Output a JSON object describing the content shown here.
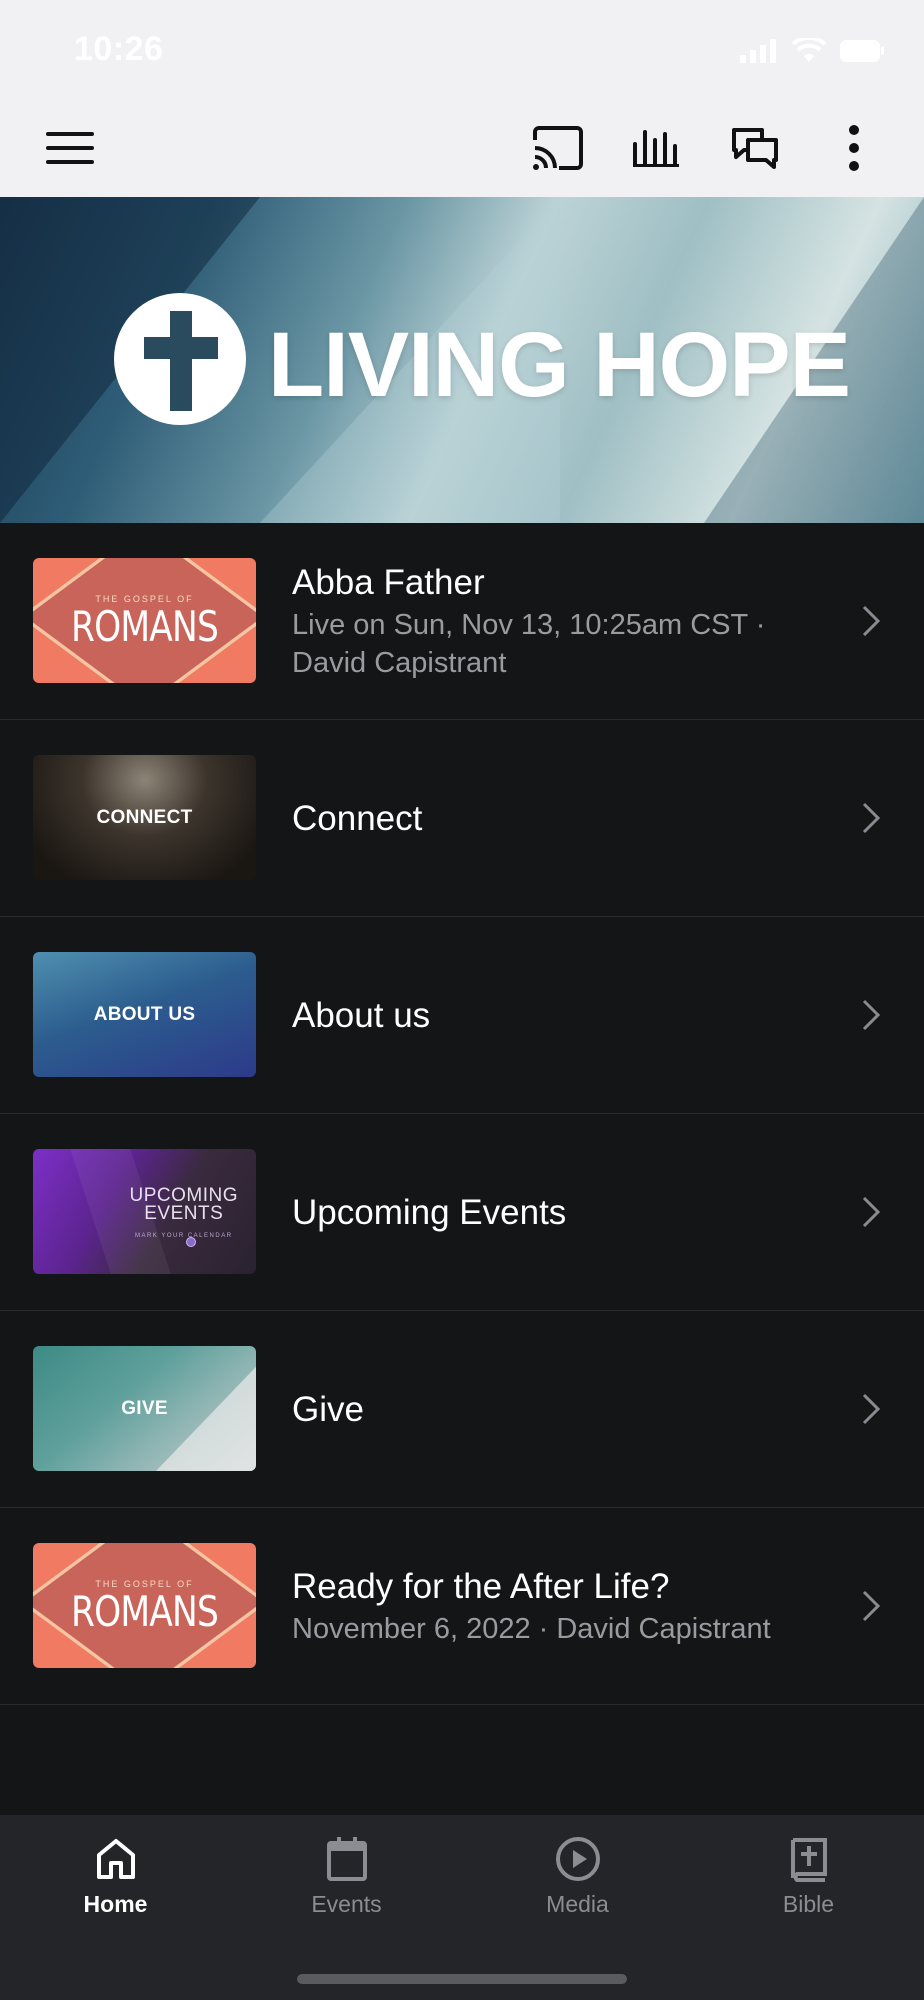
{
  "status_bar": {
    "time": "10:26"
  },
  "toolbar": {
    "menu_icon": "hamburger-menu-icon",
    "cast_icon": "cast-icon",
    "audio_icon": "audio-bars-icon",
    "chat_icon": "chat-bubbles-icon",
    "more_icon": "more-vertical-icon"
  },
  "hero": {
    "title": "LIVING HOPE",
    "logo_icon": "cross-icon"
  },
  "list": {
    "items": [
      {
        "title": "Abba Father",
        "subtitle": "Live on Sun, Nov 13, 10:25am CST · David Capistrant",
        "thumb_small": "THE GOSPEL OF",
        "thumb_big": "ROMANS"
      },
      {
        "title": "Connect",
        "thumb_text": "CONNECT"
      },
      {
        "title": "About us",
        "thumb_text": "ABOUT US"
      },
      {
        "title": "Upcoming Events",
        "thumb_line1": "UPCOMING",
        "thumb_line2": "EVENTS",
        "thumb_sub": "MARK YOUR CALENDAR"
      },
      {
        "title": "Give",
        "thumb_text": "GIVE"
      },
      {
        "title": "Ready for the After Life?",
        "subtitle": "November 6, 2022 · David Capistrant",
        "thumb_small": "THE GOSPEL OF",
        "thumb_big": "ROMANS"
      }
    ]
  },
  "bottom_nav": {
    "items": [
      {
        "label": "Home",
        "icon": "home-icon",
        "active": true
      },
      {
        "label": "Events",
        "icon": "calendar-icon",
        "active": false
      },
      {
        "label": "Media",
        "icon": "play-circle-icon",
        "active": false
      },
      {
        "label": "Bible",
        "icon": "bible-book-icon",
        "active": false
      }
    ]
  },
  "colors": {
    "background": "#141517",
    "toolbar": "#f1f1f3",
    "nav_bg": "#242528",
    "text_primary": "#ffffff",
    "text_secondary": "#9a9ba0"
  }
}
